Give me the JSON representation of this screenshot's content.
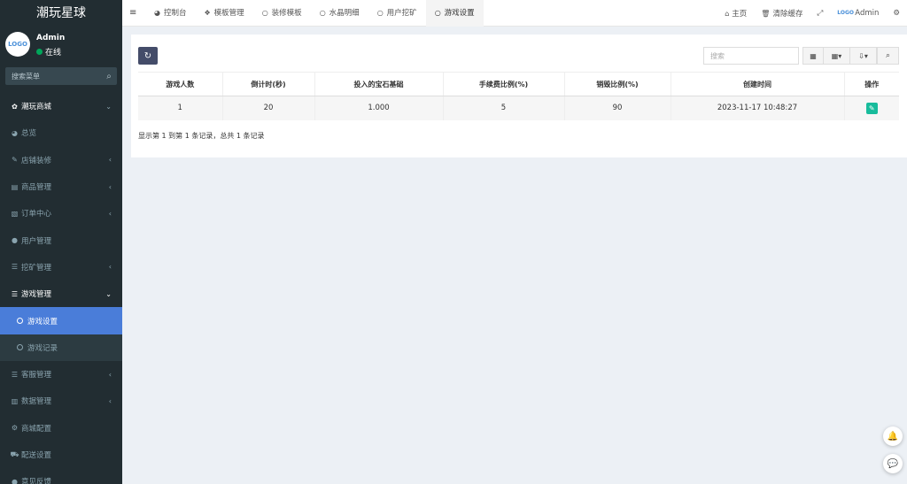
{
  "sidebar": {
    "brand": "潮玩星球",
    "user": {
      "avatar_text": "LOGO",
      "name": "Admin",
      "status": "在线"
    },
    "search_placeholder": "搜索菜单",
    "items": [
      {
        "label": "潮玩商城",
        "icon": "gear-icon",
        "glyph": "✿",
        "chevron": "⌄"
      },
      {
        "label": "总览",
        "icon": "dashboard-icon",
        "glyph": "◕",
        "chevron": ""
      },
      {
        "label": "店铺装修",
        "icon": "brush-icon",
        "glyph": "✎",
        "chevron": "‹"
      },
      {
        "label": "商品管理",
        "icon": "box-icon",
        "glyph": "▤",
        "chevron": "‹"
      },
      {
        "label": "订单中心",
        "icon": "document-icon",
        "glyph": "▧",
        "chevron": "‹"
      },
      {
        "label": "用户管理",
        "icon": "user-icon",
        "glyph": "●",
        "chevron": ""
      },
      {
        "label": "挖矿管理",
        "icon": "list-icon",
        "glyph": "☰",
        "chevron": "‹"
      },
      {
        "label": "游戏管理",
        "icon": "list-icon",
        "glyph": "☰",
        "chevron": "⌄"
      },
      {
        "label": "游戏设置",
        "icon": "circle-icon",
        "glyph": "",
        "chevron": ""
      },
      {
        "label": "游戏记录",
        "icon": "circle-icon",
        "glyph": "",
        "chevron": ""
      },
      {
        "label": "客服管理",
        "icon": "list-icon",
        "glyph": "☰",
        "chevron": "‹"
      },
      {
        "label": "数据管理",
        "icon": "bar-chart-icon",
        "glyph": "▥",
        "chevron": "‹"
      },
      {
        "label": "商城配置",
        "icon": "cogs-icon",
        "glyph": "⚙",
        "chevron": ""
      },
      {
        "label": "配送设置",
        "icon": "car-icon",
        "glyph": "⛟",
        "chevron": ""
      },
      {
        "label": "意见反馈",
        "icon": "comment-icon",
        "glyph": "●",
        "chevron": ""
      }
    ]
  },
  "topbar": {
    "toggle": "≡",
    "tabs": [
      {
        "label": "控制台",
        "icon": "dashboard-icon",
        "glyph": "◕"
      },
      {
        "label": "模板管理",
        "icon": "cubes-icon",
        "glyph": "❖"
      },
      {
        "label": "装修模板",
        "icon": "circle-icon",
        "glyph": "○"
      },
      {
        "label": "水晶明细",
        "icon": "circle-icon",
        "glyph": "○"
      },
      {
        "label": "用户挖矿",
        "icon": "circle-icon",
        "glyph": "○"
      },
      {
        "label": "游戏设置",
        "icon": "circle-icon",
        "glyph": "○"
      }
    ],
    "right": {
      "home": "主页",
      "home_glyph": "⌂",
      "clear_cache": "清除缓存",
      "clear_glyph": "🗑",
      "fullscreen_glyph": "⤢",
      "avatar_text": "LOGO",
      "admin": "Admin",
      "settings_glyph": "⚙"
    }
  },
  "toolbar": {
    "refresh_glyph": "↻",
    "search_placeholder": "搜索",
    "view_glyph": "▦",
    "columns_glyph": "▦▾",
    "export_glyph": "⇩▾",
    "search_glyph": "⌕"
  },
  "table": {
    "columns": [
      "游戏人数",
      "倒计时(秒)",
      "投入的宝石基础",
      "手续费比例(%)",
      "销毁比例(%)",
      "创建时间",
      "操作"
    ],
    "rows": [
      {
        "players": "1",
        "countdown": "20",
        "gem_base": "1.000",
        "fee_ratio": "5",
        "destroy_ratio": "90",
        "created": "2023-11-17 10:48:27",
        "edit_glyph": "✎"
      }
    ],
    "pagination": "显示第 1 到第 1 条记录，总共 1 条记录"
  },
  "floating": {
    "bell_glyph": "🔔",
    "chat_glyph": "💬"
  },
  "colors": {
    "sidebar_bg": "#222d32",
    "active_item": "#4a7dd9",
    "accent_green": "#18bc9c",
    "refresh_btn": "#444c69",
    "online": "#00a65a"
  }
}
